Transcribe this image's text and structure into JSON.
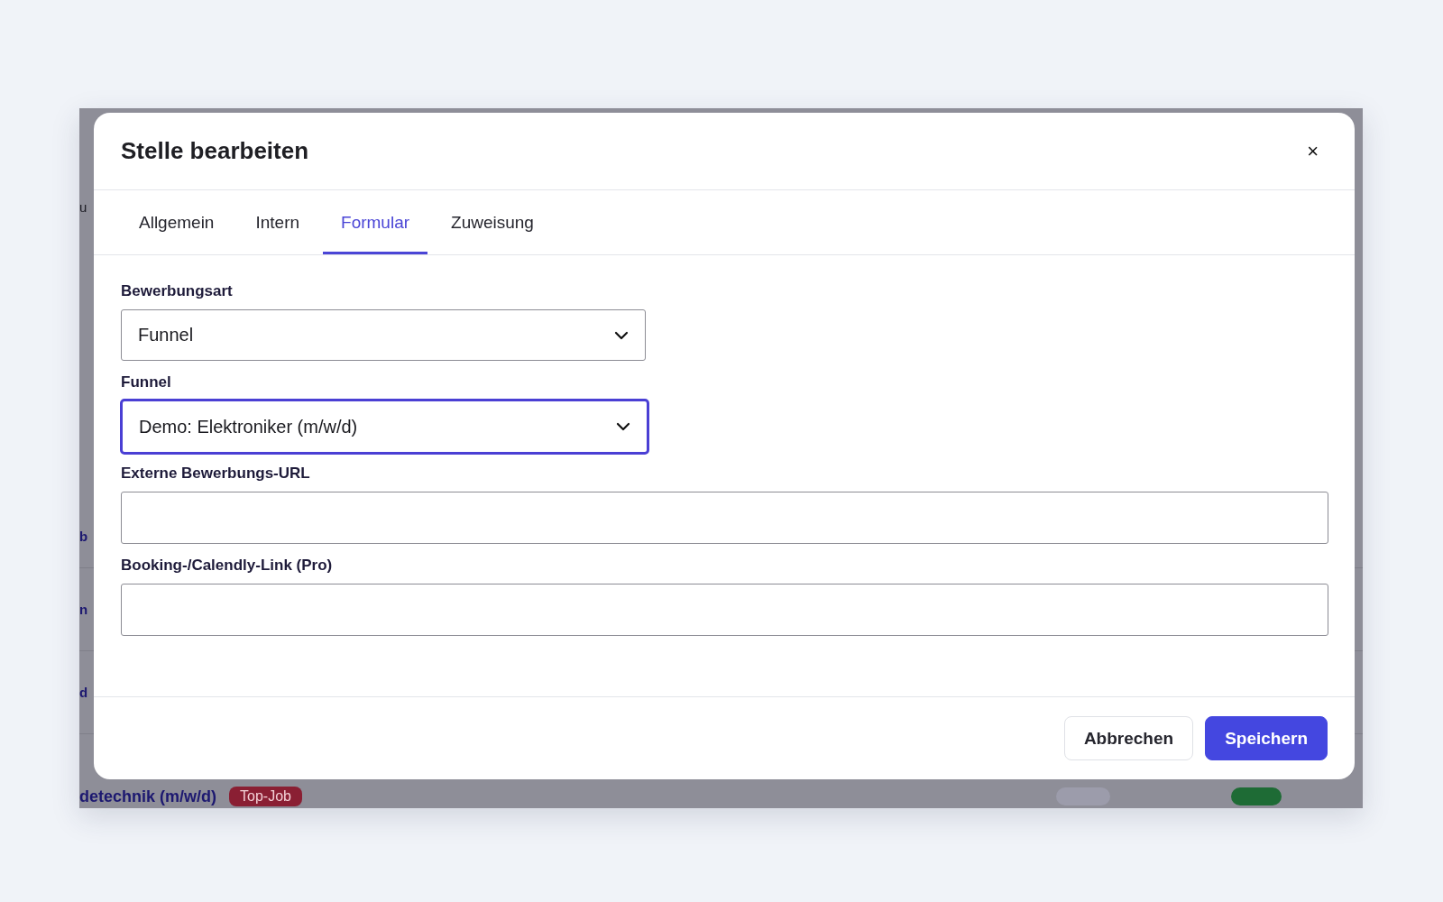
{
  "background": {
    "fragments": [
      {
        "text": "u",
        "kind": "plain"
      },
      {
        "text": "b",
        "kind": "link"
      },
      {
        "text": "n",
        "kind": "link"
      },
      {
        "text": "d",
        "kind": "link"
      }
    ],
    "last_row": {
      "title": "detechnik (m/w/d)",
      "badge": "Top-Job",
      "toggle_on": true
    }
  },
  "dialog": {
    "title": "Stelle bearbeiten",
    "close": "×",
    "tabs": [
      {
        "label": "Allgemein",
        "selected": false
      },
      {
        "label": "Intern",
        "selected": false
      },
      {
        "label": "Formular",
        "selected": true
      },
      {
        "label": "Zuweisung",
        "selected": false
      }
    ],
    "fields": [
      {
        "label": "Bewerbungsart",
        "kind": "select",
        "value": "Funnel",
        "focused": false
      },
      {
        "label": "Funnel",
        "kind": "select",
        "value": "Demo: Elektroniker (m/w/d)",
        "focused": true
      },
      {
        "label": "Externe Bewerbungs-URL",
        "kind": "text",
        "focused": false
      },
      {
        "label": "Booking-/Calendly-Link (Pro)",
        "kind": "text",
        "focused": false
      }
    ],
    "buttons": [
      {
        "label": "Abbrechen",
        "kind": "secondary"
      },
      {
        "label": "Speichern",
        "kind": "primary"
      }
    ]
  }
}
